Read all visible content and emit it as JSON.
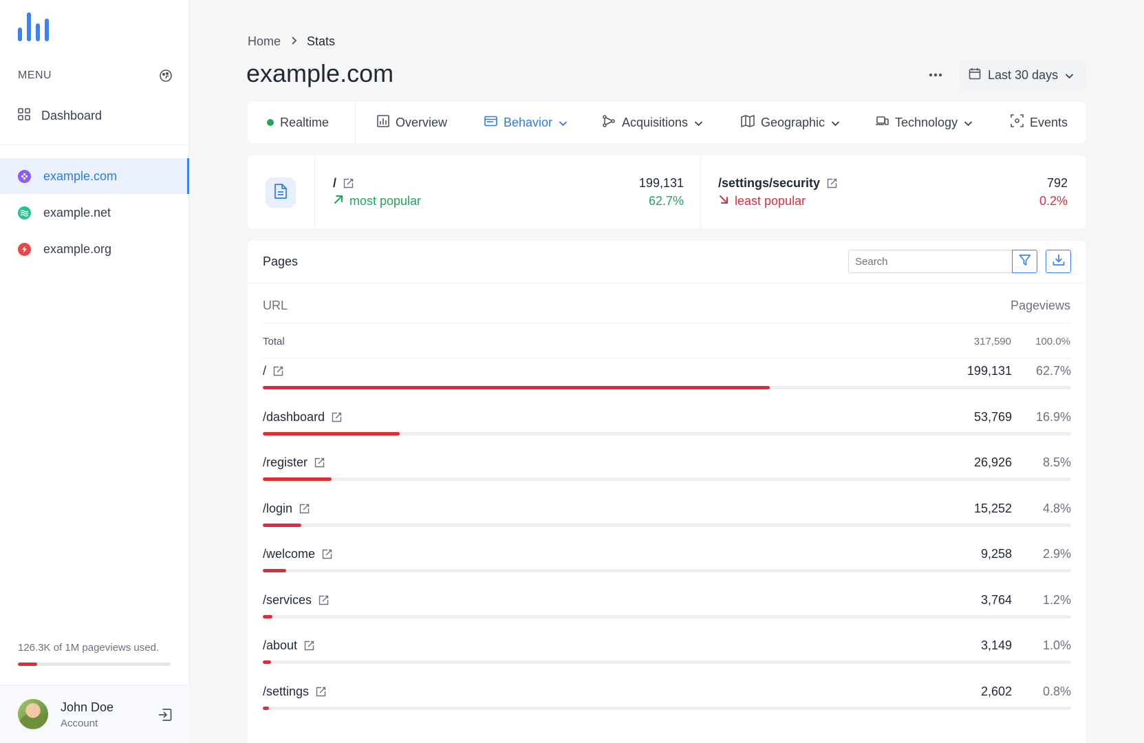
{
  "sidebar": {
    "menu_label": "MENU",
    "dashboard_label": "Dashboard",
    "sites": [
      {
        "label": "example.com",
        "color": "#8b5cf6"
      },
      {
        "label": "example.net",
        "color": "#22c38e"
      },
      {
        "label": "example.org",
        "color": "#ef4444"
      }
    ],
    "usage_text": "126.3K of 1M pageviews used.",
    "usage_fraction": 0.126,
    "account": {
      "name": "John Doe",
      "sub": "Account"
    }
  },
  "breadcrumb": {
    "home": "Home",
    "current": "Stats"
  },
  "page_title": "example.com",
  "date_range": "Last 30 days",
  "tabs": [
    {
      "label": "Realtime"
    },
    {
      "label": "Overview"
    },
    {
      "label": "Behavior"
    },
    {
      "label": "Acquisitions"
    },
    {
      "label": "Geographic"
    },
    {
      "label": "Technology"
    },
    {
      "label": "Events"
    }
  ],
  "highlights": {
    "most": {
      "path": "/",
      "label": "most popular",
      "count": "199,131",
      "pct": "62.7%"
    },
    "least": {
      "path": "/settings/security",
      "label": "least popular",
      "count": "792",
      "pct": "0.2%"
    }
  },
  "pages": {
    "title": "Pages",
    "search_placeholder": "Search",
    "col_url": "URL",
    "col_pageviews": "Pageviews",
    "total_label": "Total",
    "total_count": "317,590",
    "total_pct": "100.0%",
    "rows": [
      {
        "url": "/",
        "count": "199,131",
        "pct": "62.7%",
        "fraction": 0.627
      },
      {
        "url": "/dashboard",
        "count": "53,769",
        "pct": "16.9%",
        "fraction": 0.169
      },
      {
        "url": "/register",
        "count": "26,926",
        "pct": "8.5%",
        "fraction": 0.085
      },
      {
        "url": "/login",
        "count": "15,252",
        "pct": "4.8%",
        "fraction": 0.048
      },
      {
        "url": "/welcome",
        "count": "9,258",
        "pct": "2.9%",
        "fraction": 0.029
      },
      {
        "url": "/services",
        "count": "3,764",
        "pct": "1.2%",
        "fraction": 0.012
      },
      {
        "url": "/about",
        "count": "3,149",
        "pct": "1.0%",
        "fraction": 0.01
      },
      {
        "url": "/settings",
        "count": "2,602",
        "pct": "0.8%",
        "fraction": 0.008
      }
    ]
  },
  "colors": {
    "accent": "#2b7be3",
    "bar": "#dc2f3c",
    "positive": "#22a55a",
    "negative": "#dc2f3c"
  }
}
